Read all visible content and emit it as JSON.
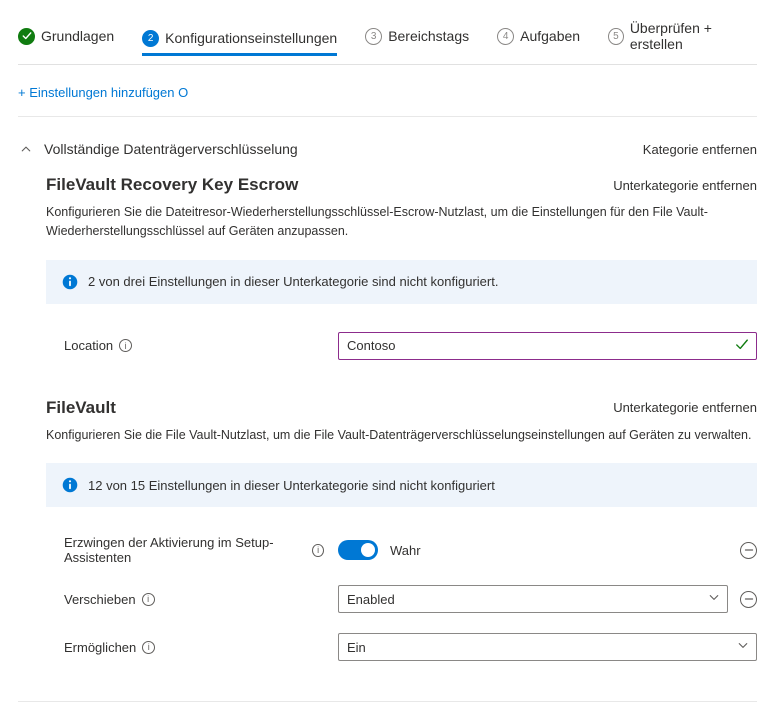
{
  "stepper": [
    {
      "num": "✓",
      "label": "Grundlagen",
      "state": "done"
    },
    {
      "num": "2",
      "label": "Konfigurationseinstellungen",
      "state": "active"
    },
    {
      "num": "3",
      "label": "Bereichstags",
      "state": "pending"
    },
    {
      "num": "4",
      "label": "Aufgaben",
      "state": "pending"
    },
    {
      "num": "5",
      "label": "Überprüfen + erstellen",
      "state": "pending"
    }
  ],
  "addSettings": "+ Einstellungen hinzufügen O",
  "category": {
    "title": "Vollständige Datenträgerverschlüsselung",
    "remove": "Kategorie entfernen"
  },
  "sub1": {
    "title": "FileVault Recovery Key Escrow",
    "remove": "Unterkategorie entfernen",
    "desc": "Konfigurieren Sie die Dateitresor-Wiederherstellungsschlüssel-Escrow-Nutzlast, um die Einstellungen für den File Vault-Wiederherstellungsschlüssel auf Geräten anzupassen.",
    "info": "2 von drei Einstellungen in dieser Unterkategorie sind nicht konfiguriert.",
    "location": {
      "label": "Location",
      "value": "Contoso"
    }
  },
  "sub2": {
    "title": "FileVault",
    "remove": "Unterkategorie entfernen",
    "desc": "Konfigurieren Sie die File Vault-Nutzlast, um die File Vault-Datenträgerverschlüsselungseinstellungen auf Geräten zu verwalten.",
    "info": "12 von 15 Einstellungen in dieser Unterkategorie sind nicht konfiguriert",
    "forceEnable": {
      "label": "Erzwingen der Aktivierung im Setup-Assistenten",
      "value": "Wahr"
    },
    "defer": {
      "label": "Verschieben",
      "value": "Enabled"
    },
    "enable": {
      "label": "Ermöglichen",
      "value": "Ein"
    }
  }
}
